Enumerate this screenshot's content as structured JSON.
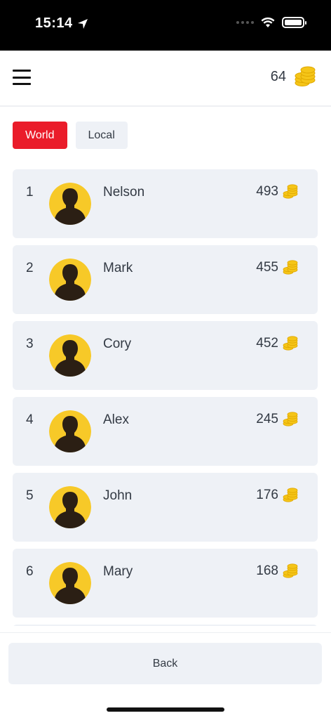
{
  "status_bar": {
    "time": "15:14",
    "icons": [
      "location-arrow-icon",
      "cellular-dots-icon",
      "wifi-icon",
      "battery-icon"
    ]
  },
  "header": {
    "menu_icon": "hamburger-menu-icon",
    "coin_balance": "64",
    "coin_icon": "coin-stack-icon"
  },
  "tabs": [
    {
      "label": "World",
      "active": true
    },
    {
      "label": "Local",
      "active": false
    }
  ],
  "leaderboard": [
    {
      "rank": "1",
      "name": "Nelson",
      "score": "493"
    },
    {
      "rank": "2",
      "name": "Mark",
      "score": "455"
    },
    {
      "rank": "3",
      "name": "Cory",
      "score": "452"
    },
    {
      "rank": "4",
      "name": "Alex",
      "score": "245"
    },
    {
      "rank": "5",
      "name": "John",
      "score": "176"
    },
    {
      "rank": "6",
      "name": "Mary",
      "score": "168"
    },
    {
      "rank": "",
      "name": "",
      "score": ""
    }
  ],
  "footer": {
    "back_label": "Back"
  },
  "colors": {
    "accent": "#ea1c2a",
    "row_bg": "#eef1f6",
    "coin": "#f5c518",
    "avatar_bg": "#f7c928"
  }
}
